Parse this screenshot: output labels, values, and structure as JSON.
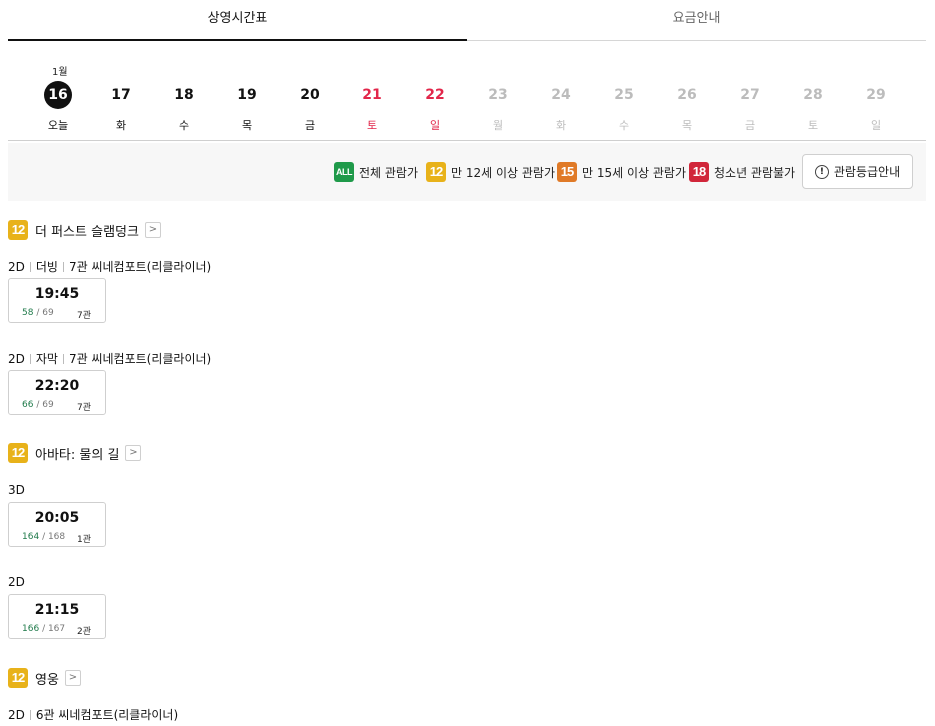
{
  "tabs": [
    {
      "label": "상영시간표",
      "active": true
    },
    {
      "label": "요금안내",
      "active": false
    }
  ],
  "month_label": "1월",
  "dates": [
    {
      "num": "16",
      "dow": "오늘",
      "state": "sel"
    },
    {
      "num": "17",
      "dow": "화",
      "state": "normal"
    },
    {
      "num": "18",
      "dow": "수",
      "state": "normal"
    },
    {
      "num": "19",
      "dow": "목",
      "state": "normal"
    },
    {
      "num": "20",
      "dow": "금",
      "state": "normal"
    },
    {
      "num": "21",
      "dow": "토",
      "state": "red"
    },
    {
      "num": "22",
      "dow": "일",
      "state": "red"
    },
    {
      "num": "23",
      "dow": "월",
      "state": "dis"
    },
    {
      "num": "24",
      "dow": "화",
      "state": "dis"
    },
    {
      "num": "25",
      "dow": "수",
      "state": "dis"
    },
    {
      "num": "26",
      "dow": "목",
      "state": "dis"
    },
    {
      "num": "27",
      "dow": "금",
      "state": "dis"
    },
    {
      "num": "28",
      "dow": "토",
      "state": "dis"
    },
    {
      "num": "29",
      "dow": "일",
      "state": "dis"
    }
  ],
  "legend": {
    "all": {
      "badge": "ALL",
      "label": "전체 관람가"
    },
    "r12": {
      "badge": "12",
      "label": "만 12세 이상 관람가"
    },
    "r15": {
      "badge": "15",
      "label": "만 15세 이상 관람가"
    },
    "r18": {
      "badge": "18",
      "label": "청소년 관람불가"
    },
    "guide_button": "관람등급안내",
    "guide_icon": "!"
  },
  "arrow_glyph": ">",
  "movies": [
    {
      "rating": "12",
      "title": "더 퍼스트 슬램덩크",
      "showings": [
        {
          "format": "2D",
          "language": "더빙",
          "hall_info": "7관 씨네컴포트(리클라이너)",
          "time": "19:45",
          "available": "58",
          "total": "/ 69",
          "hall": "7관"
        },
        {
          "format": "2D",
          "language": "자막",
          "hall_info": "7관 씨네컴포트(리클라이너)",
          "time": "22:20",
          "available": "66",
          "total": "/ 69",
          "hall": "7관"
        }
      ]
    },
    {
      "rating": "12",
      "title": "아바타: 물의 길",
      "showings": [
        {
          "format": "3D",
          "time": "20:05",
          "available": "164",
          "total": "/ 168",
          "hall": "1관"
        },
        {
          "format": "2D",
          "time": "21:15",
          "available": "166",
          "total": "/ 167",
          "hall": "2관"
        }
      ]
    },
    {
      "rating": "12",
      "title": "영웅",
      "showings": [
        {
          "format": "2D",
          "hall_info": "6관 씨네컴포트(리클라이너)"
        }
      ]
    }
  ],
  "colors": {
    "rating_all": "#1f9a4a",
    "rating_12": "#e8b21a",
    "rating_15": "#e07a27",
    "rating_18": "#d1263a",
    "weekend": "#e2264a",
    "available_seats": "#1f7a4a"
  }
}
